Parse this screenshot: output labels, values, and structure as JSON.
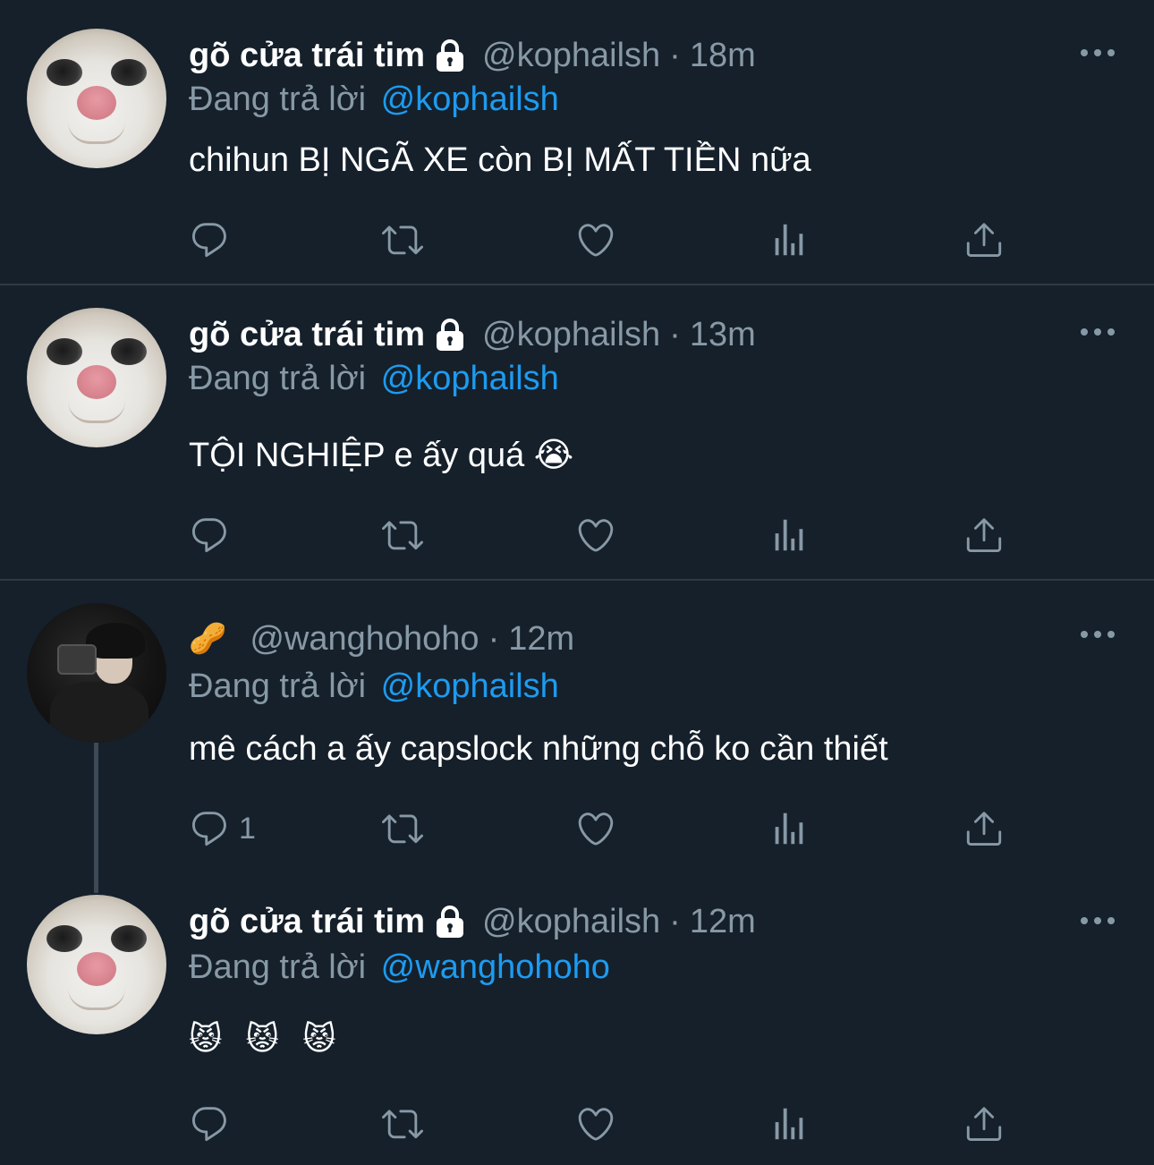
{
  "colors": {
    "background": "#15202b",
    "text_primary": "#ffffff",
    "text_secondary": "#8899a6",
    "link": "#1d9bf0",
    "divider": "#2f3a46"
  },
  "reply_prefix": "Đang trả lời",
  "tweets": [
    {
      "avatar": "cat-closeup-avatar",
      "display_name": "gõ cửa trái tim",
      "protected_icon": "lock-icon",
      "handle": "@kophailsh",
      "separator": "·",
      "time": "18m",
      "reply_to": "@kophailsh",
      "text": "chihun BỊ NGÃ XE còn BỊ MẤT TIỀN nữa",
      "reply_count": ""
    },
    {
      "avatar": "cat-closeup-avatar",
      "display_name": "gõ cửa trái tim",
      "protected_icon": "lock-icon",
      "handle": "@kophailsh",
      "separator": "·",
      "time": "13m",
      "reply_to": "@kophailsh",
      "text": "TỘI NGHIỆP e ấy quá 😭",
      "reply_count": ""
    },
    {
      "avatar": "person-with-camera-avatar",
      "display_name": "🥜",
      "handle": "@wanghohoho",
      "separator": "·",
      "time": "12m",
      "reply_to": "@kophailsh",
      "text": "mê cách a ấy capslock những chỗ ko cần thiết",
      "reply_count": "1"
    },
    {
      "avatar": "cat-closeup-avatar",
      "display_name": "gõ cửa trái tim",
      "protected_icon": "lock-icon",
      "handle": "@kophailsh",
      "separator": "·",
      "time": "12m",
      "reply_to": "@wanghohoho",
      "text": "😾 😾 😾",
      "reply_count": ""
    }
  ],
  "action_icons": [
    "reply-icon",
    "retweet-icon",
    "like-icon",
    "analytics-icon",
    "share-icon"
  ]
}
